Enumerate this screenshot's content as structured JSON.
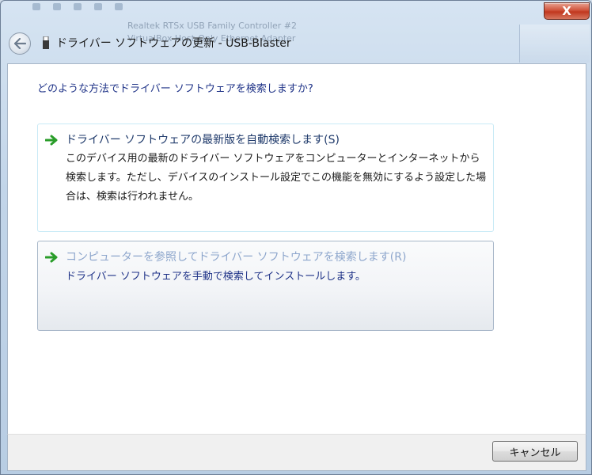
{
  "window": {
    "title": "ドライバー ソフトウェアの更新 - USB-Blaster",
    "close_label": "X"
  },
  "background": {
    "rows": [
      "Realtek RTSx USB Family Controller #2",
      "VirtualBox Host-Only Ethernet Adapter"
    ]
  },
  "main": {
    "heading": "どのような方法でドライバー ソフトウェアを検索しますか?",
    "options": [
      {
        "title": "ドライバー ソフトウェアの最新版を自動検索します(S)",
        "description": "このデバイス用の最新のドライバー ソフトウェアをコンピューターとインターネットから検索します。ただし、デバイスのインストール設定でこの機能を無効にするよう設定した場合は、検索は行われません。"
      },
      {
        "title": "コンピューターを参照してドライバー ソフトウェアを検索します(R)",
        "description": "ドライバー ソフトウェアを手動で検索してインストールします。"
      }
    ]
  },
  "footer": {
    "cancel_label": "キャンセル"
  },
  "colors": {
    "heading": "#1e3287",
    "arrow": "#2a9d2a",
    "close": "#c1381f"
  }
}
